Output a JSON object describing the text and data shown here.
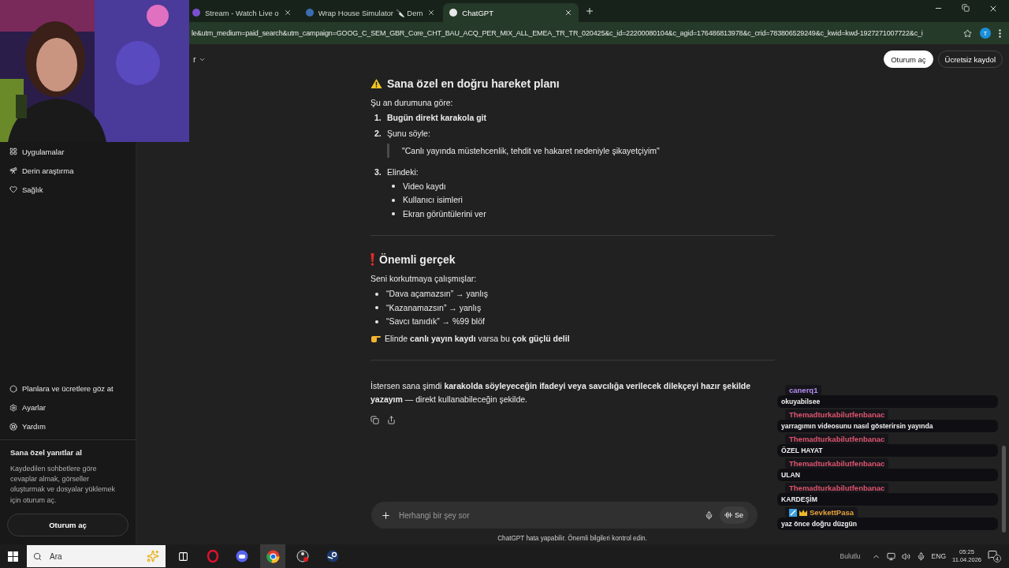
{
  "browser": {
    "tabs": [
      {
        "label": "Stream - Watch Live o",
        "selected": false
      },
      {
        "label": "Wrap House Simulator 🔪 Dem",
        "selected": false
      },
      {
        "label": "ChatGPT",
        "selected": true
      }
    ],
    "url": "le&utm_medium=paid_search&utm_campaign=GOOG_C_SEM_GBR_Core_CHT_BAU_ACQ_PER_MIX_ALL_EMEA_TR_TR_020425&c_id=22200080104&c_agid=176486813978&c_crid=783806529249&c_kwid=kwd-1927271007722&c_i",
    "profile": "T"
  },
  "header": {
    "model_label": "r",
    "buttons": [
      "Oturum aç",
      "Ücretsiz kaydol"
    ]
  },
  "sidebar": {
    "items": [
      "Uygulamalar",
      "Derin araştırma",
      "Sağlık"
    ],
    "footer_items": [
      "Planlara ve ücretlere göz at",
      "Ayarlar",
      "Yardım"
    ],
    "promo": {
      "title": "Sana özel yanıtlar al",
      "text": "Kaydedilen sohbetlere göre cevaplar almak, görseller oluşturmak ve dosyalar yüklemek için oturum aç.",
      "button": "Oturum aç"
    }
  },
  "answer": {
    "sections": [
      {
        "kind": "warning",
        "heading": "Sana özel en doğru hareket planı",
        "intro": "Şu an durumuna göre:",
        "steps": [
          {
            "number": "1.",
            "text": "Bugün direkt karakola git",
            "strong": true
          },
          {
            "number": "2.",
            "text": "Şunu söyle:",
            "strong": false,
            "quote": "\"Canlı yayında müstehcenlik, tehdit ve hakaret nedeniyle şikayetçiyim\""
          },
          {
            "number": "3.",
            "text": "Elindeki:",
            "strong": false,
            "bullets": [
              "Video kaydı",
              "Kullanıcı isimleri",
              "Ekran görüntülerini ver"
            ]
          }
        ]
      },
      {
        "kind": "alert",
        "heading": "Önemli gerçek",
        "intro": "Seni korkutmaya çalışmışlar:",
        "bullets": [
          "“Dava açamazsın” → yanlış",
          "“Kazanamazsın” → yanlış",
          "“Savcı tanıdık” → %99 blöf"
        ],
        "note": "Elinde **canlı yayın kaydı** varsa bu **çok güçlü delil**"
      }
    ],
    "closing": "İstersen sana şimdi **karakolda söyleyeceğin ifadeyi veya savcılığa verilecek dilekçeyi hazır şekilde yazayım** — direkt kullanabileceğin şekilde."
  },
  "composer": {
    "placeholder": "Herhangi bir şey sor",
    "voice_label": "Se",
    "disclaimer": "ChatGPT hata yapabilir. Önemli bilgileri kontrol edin."
  },
  "chat": {
    "messages": [
      {
        "user": "canerq1",
        "color": "#b48cf0",
        "text": "okuyabilsee",
        "kind": "plain"
      },
      {
        "user": "Themadturkabilutfenbanac",
        "color": "#e0556e",
        "text": "yarragımın videosunu nasıl gösterirsin yayında",
        "kind": "plain"
      },
      {
        "user": "Themadturkabilutfenbanac",
        "color": "#e0556e",
        "text": "ÖZEL HAYAT",
        "kind": "plain"
      },
      {
        "user": "Themadturkabilutfenbanac",
        "color": "#e0556e",
        "text": "ULAN",
        "kind": "plain"
      },
      {
        "user": "Themadturkabilutfenbanac",
        "color": "#e0556e",
        "text": "KARDEŞİM",
        "kind": "plain"
      },
      {
        "user": "SevkettPasa",
        "color": "#e8a23a",
        "text": "yaz önce doğru düzgün",
        "kind": "badged"
      }
    ]
  },
  "taskbar": {
    "search_placeholder": "Ara",
    "weather": "Bulutlu",
    "language": "ENG",
    "time": "05:25",
    "date": "11.04.2026",
    "notifications": "4"
  }
}
